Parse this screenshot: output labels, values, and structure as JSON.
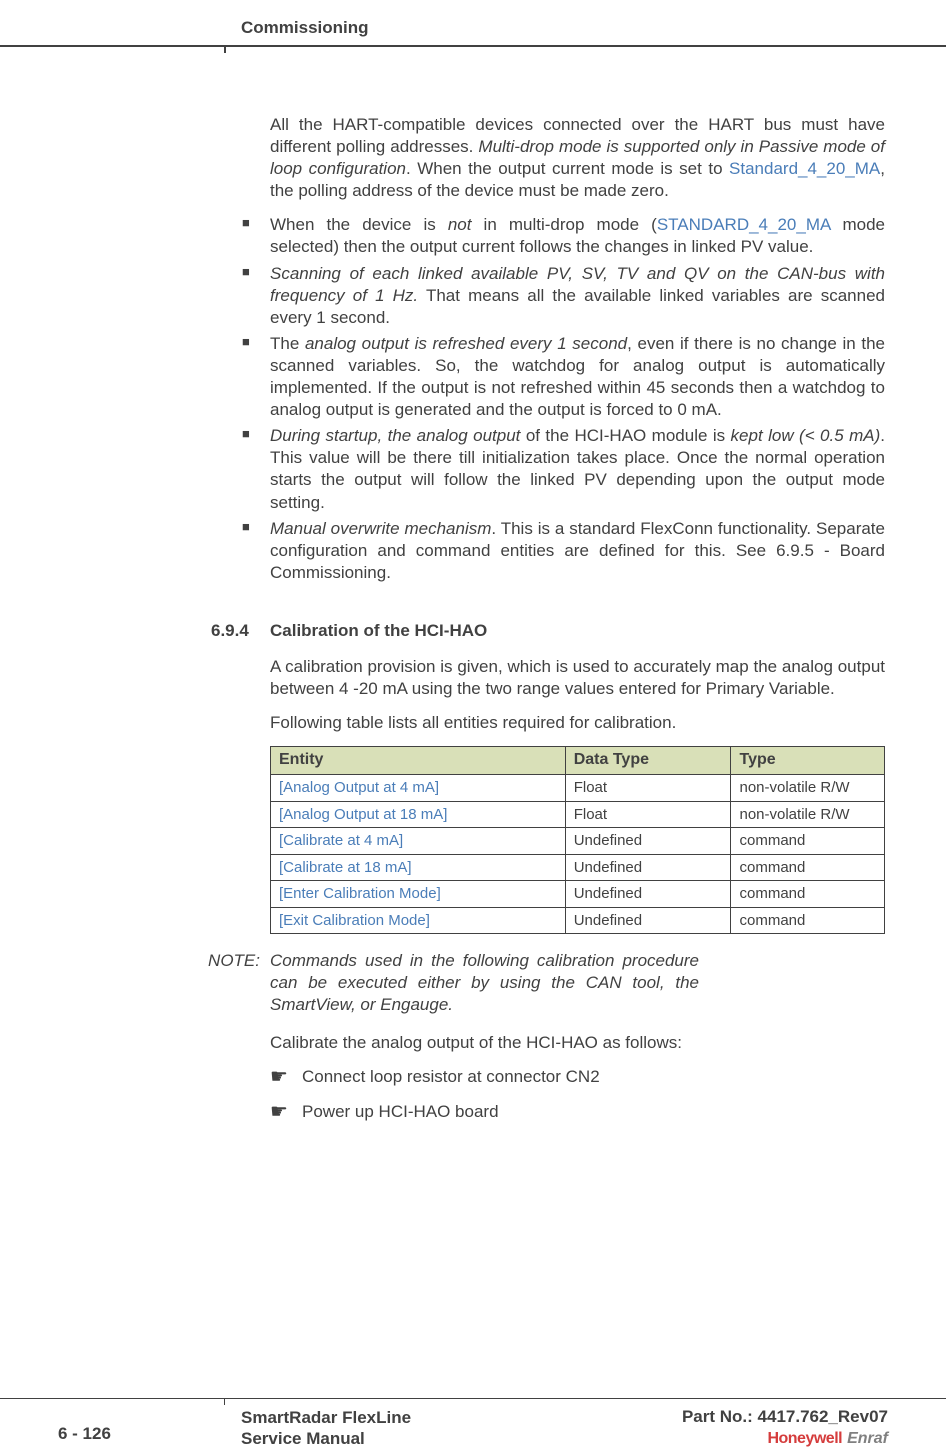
{
  "header": {
    "title": "Commissioning"
  },
  "intro": {
    "text_parts": [
      "All the HART-compatible devices connected over the HART bus must have different polling addresses. ",
      "Multi-drop mode is supported only in Passive mode of loop configuration",
      ". When the output current mode is set to ",
      "Standard_4_20_MA",
      ", the polling address of the device must be made zero."
    ]
  },
  "bullets": [
    {
      "parts": [
        {
          "text": "When the device is ",
          "italic": false
        },
        {
          "text": "not",
          "italic": true
        },
        {
          "text": " in multi-drop mode (",
          "italic": false
        },
        {
          "text": "STANDARD_4_20_MA",
          "blue": true
        },
        {
          "text": " mode selected) then the output current follows the changes in linked PV value.",
          "italic": false
        }
      ]
    },
    {
      "parts": [
        {
          "text": "Scanning of each linked available PV, SV, TV and QV on the CAN-bus with frequency of 1 Hz.",
          "italic": true
        },
        {
          "text": " That means all the available linked variables are scanned every 1 second.",
          "italic": false
        }
      ]
    },
    {
      "parts": [
        {
          "text": "The ",
          "italic": false
        },
        {
          "text": "analog output is refreshed every 1 second",
          "italic": true
        },
        {
          "text": ", even if there is no change in the scanned variables. So, the watchdog for analog output is automatically implemented. If the output is not refreshed within 45 seconds then a watchdog to analog output is generated and the output is forced to 0 mA.",
          "italic": false
        }
      ]
    },
    {
      "parts": [
        {
          "text": "During startup, the analog output",
          "italic": true
        },
        {
          "text": " of the HCI-HAO module is ",
          "italic": false
        },
        {
          "text": "kept low (< 0.5 mA)",
          "italic": true
        },
        {
          "text": ". This value will be there till initialization takes place. Once the normal operation starts the output will follow the linked PV depending upon the output mode setting.",
          "italic": false
        }
      ]
    },
    {
      "parts": [
        {
          "text": "Manual overwrite mechanism",
          "italic": true
        },
        {
          "text": ". This is a standard FlexConn functionality. Separate configuration and command entities are defined for this. See 6.9.5 - Board Commissioning.",
          "italic": false
        }
      ]
    }
  ],
  "section": {
    "number": "6.9.4",
    "title": "Calibration of the HCI-HAO",
    "para1": "A calibration provision is given, which is used to accurately map the analog output between 4 -20 mA using the two range values entered for Primary Variable.",
    "para2": "Following table lists all entities required for calibration."
  },
  "table": {
    "headers": [
      "Entity",
      "Data Type",
      "Type"
    ],
    "rows": [
      [
        "[Analog Output at 4 mA]",
        "Float",
        "non-volatile R/W"
      ],
      [
        "[Analog Output at 18 mA]",
        "Float",
        "non-volatile R/W"
      ],
      [
        "[Calibrate at 4 mA]",
        "Undefined",
        "command"
      ],
      [
        "[Calibrate at 18 mA]",
        "Undefined",
        "command"
      ],
      [
        "[Enter Calibration Mode]",
        "Undefined",
        "command"
      ],
      [
        "[Exit Calibration Mode]",
        "Undefined",
        "command"
      ]
    ]
  },
  "note": {
    "label": "NOTE:",
    "text": "Commands used in the following calibration procedure can be executed either by using the CAN tool, the SmartView, or Engauge."
  },
  "calibrate": {
    "intro": "Calibrate the analog output of the HCI-HAO as follows:",
    "steps": [
      "Connect loop resistor at connector CN2",
      "Power up HCI-HAO board"
    ]
  },
  "footer": {
    "page": "6 - 126",
    "center_line1": "SmartRadar FlexLine",
    "center_line2": "Service Manual",
    "partno": "Part No.: 4417.762_Rev07",
    "brand1": "Honeywell",
    "brand2": "Enraf"
  }
}
